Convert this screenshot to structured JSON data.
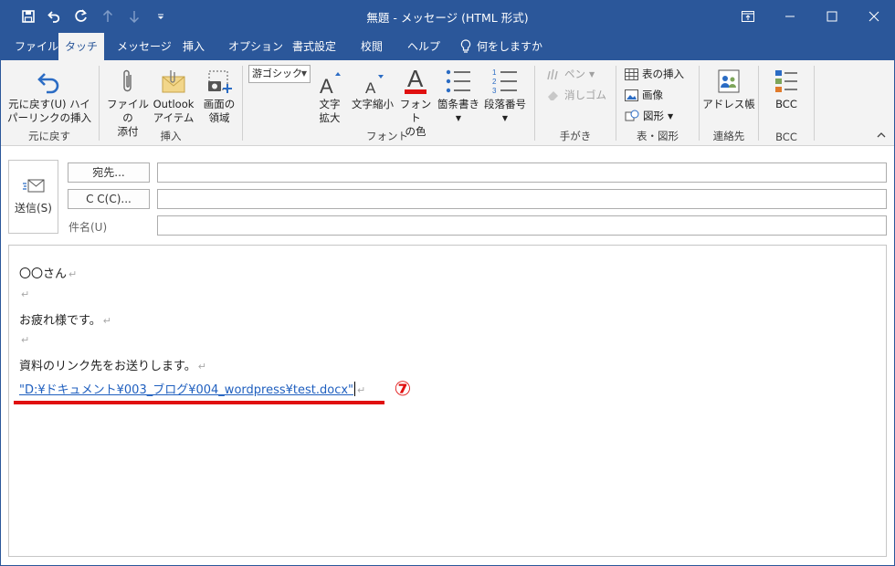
{
  "window": {
    "title": "無題 - メッセージ (HTML 形式)"
  },
  "quick_access": {
    "icons": [
      "save-icon",
      "undo-icon",
      "redo-icon",
      "up-icon",
      "down-icon",
      "customize-icon"
    ]
  },
  "tabs": [
    {
      "label": "ファイル"
    },
    {
      "label": "タッチ"
    },
    {
      "label": "メッセージ"
    },
    {
      "label": "挿入"
    },
    {
      "label": "オプション"
    },
    {
      "label": "書式設定"
    },
    {
      "label": "校閲"
    },
    {
      "label": "ヘルプ"
    },
    {
      "label": "何をしますか"
    }
  ],
  "ribbon": {
    "undo": {
      "label_line1": "元に戻す(U) ハイ",
      "label_line2": "パーリンクの挿入",
      "group": "元に戻す"
    },
    "insert": {
      "attach_line1": "ファイルの",
      "attach_line2": "添付",
      "outlook_line1": "Outlook",
      "outlook_line2": "アイテム",
      "screen_line1": "画面の",
      "screen_line2": "領域",
      "group": "挿入"
    },
    "font": {
      "font_name": "游ゴシック",
      "grow_line1": "文字",
      "grow_line2": "拡大",
      "shrink": "文字縮小",
      "color_line1": "フォント",
      "color_line2": "の色",
      "bullets": "箇条書き",
      "numbering": "段落番号",
      "group": "フォント"
    },
    "ink": {
      "pen": "ペン",
      "eraser": "消しゴム",
      "group": "手がき"
    },
    "table": {
      "insert_table": "表の挿入",
      "picture": "画像",
      "shapes": "図形",
      "group": "表・図形"
    },
    "contacts": {
      "address_book": "アドレス帳",
      "group": "連絡先"
    },
    "bcc": {
      "label": "BCC",
      "group": "BCC"
    }
  },
  "compose": {
    "send_label": "送信(S)",
    "to_label": "宛先...",
    "cc_label": "C C(C)...",
    "subject_label": "件名(U)",
    "to_value": "",
    "cc_value": "",
    "subject_value": ""
  },
  "body": {
    "lines": [
      "〇〇さん",
      "",
      "お疲れ様です。",
      "",
      "資料のリンク先をお送りします。"
    ],
    "link_text": "\"D:¥ドキュメント¥003_ブログ¥004_wordpress¥test.docx\"",
    "return_mark": "↵",
    "annotation": "⑦"
  },
  "colors": {
    "brand": "#2b579a",
    "annotation": "#e01010",
    "link": "#1f5fbf"
  }
}
